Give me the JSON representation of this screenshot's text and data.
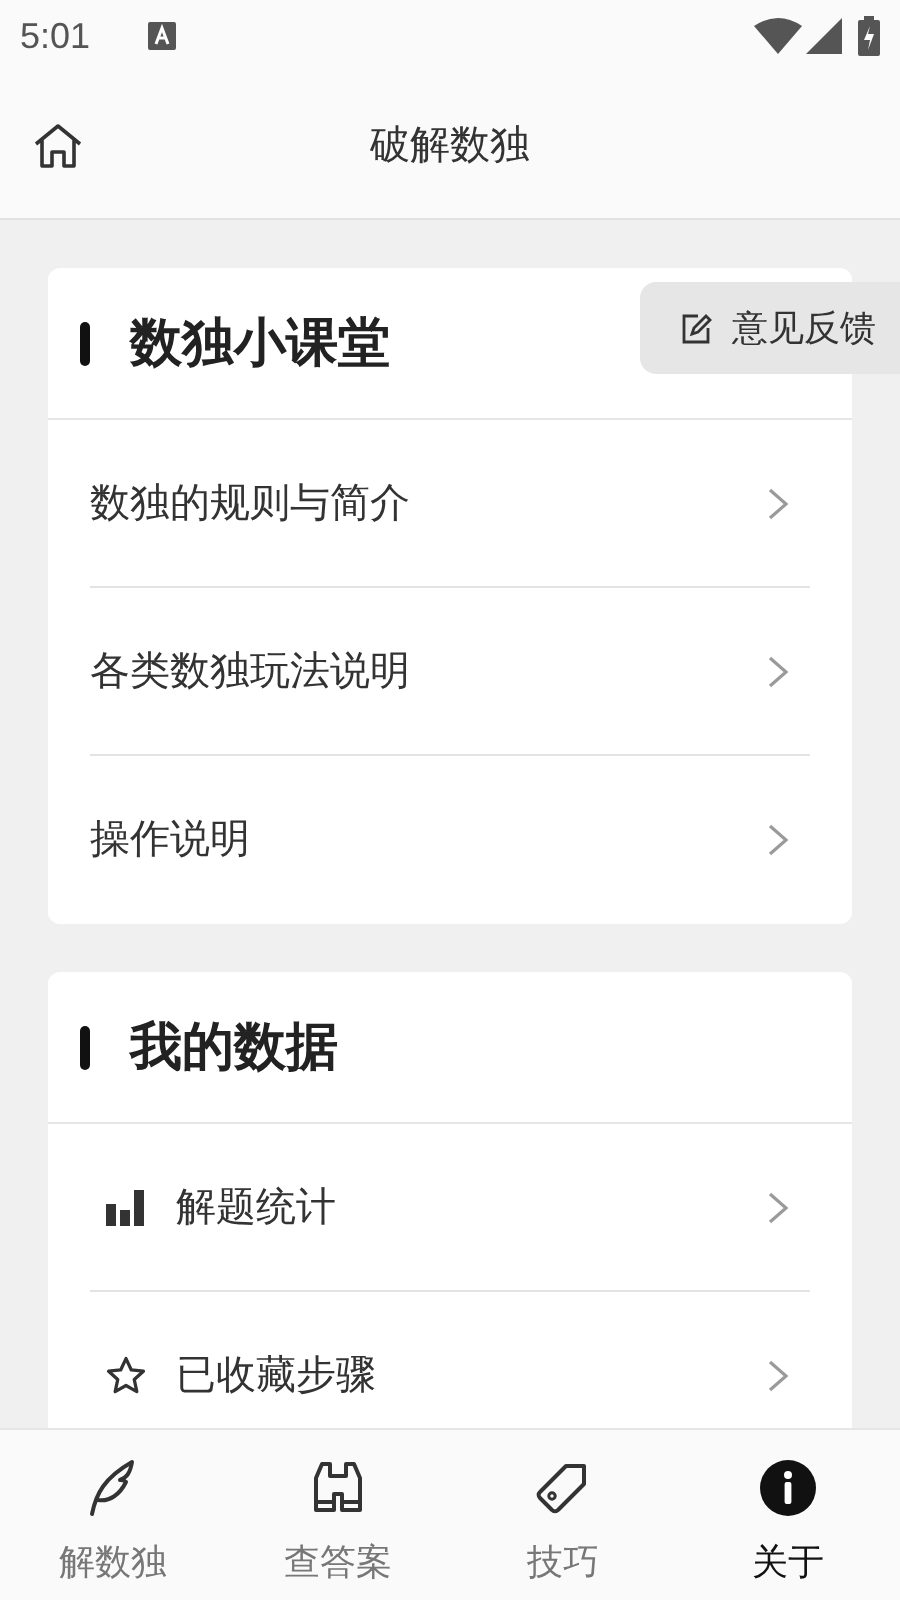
{
  "status_bar": {
    "time": "5:01"
  },
  "header": {
    "title": "破解数独"
  },
  "feedback_button": {
    "label": "意见反馈"
  },
  "sections": [
    {
      "title": "数独小课堂",
      "items": [
        {
          "label": "数独的规则与简介"
        },
        {
          "label": "各类数独玩法说明"
        },
        {
          "label": "操作说明"
        }
      ]
    },
    {
      "title": "我的数据",
      "items": [
        {
          "label": "解题统计"
        },
        {
          "label": "已收藏步骤"
        }
      ]
    }
  ],
  "tabs": [
    {
      "label": "解数独",
      "selected": false
    },
    {
      "label": "查答案",
      "selected": false
    },
    {
      "label": "技巧",
      "selected": false
    },
    {
      "label": "关于",
      "selected": true
    }
  ]
}
